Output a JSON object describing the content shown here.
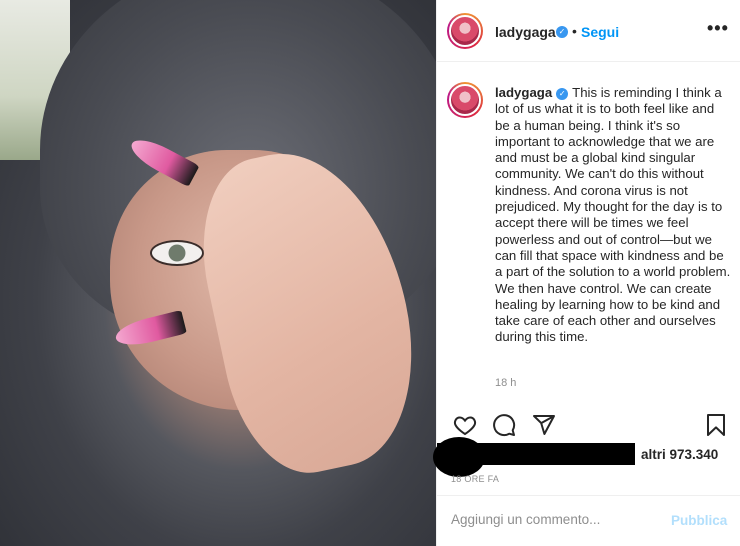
{
  "post": {
    "username": "ladygaga",
    "verified_mark": "✓",
    "separator": "•",
    "follow_label": "Segui",
    "more_label": "•••",
    "caption": "This is reminding I think a lot of us what it is to both feel like and be a human being. I think it's so important to acknowledge that we are and must be a global kind singular community. We can't do this without kindness. And corona virus is not prejudiced. My thought for the day is to accept there will be times we feel powerless and out of control—but we can fill that space with kindness and be a part of the solution to a world problem. We then have control. We can create healing by learning how to be kind and take care of each other and ourselves during this time.",
    "caption_time": "18 h",
    "likes_text": "altri 973.340",
    "posted_ago": "18 ORE FA"
  },
  "comment": {
    "placeholder": "Aggiungi un commento...",
    "publish_label": "Pubblica"
  },
  "icons": {
    "like": "heart-icon",
    "comment": "comment-bubble-icon",
    "share": "paper-plane-icon",
    "save": "bookmark-icon"
  },
  "colors": {
    "link_blue": "#0095f6",
    "verified_blue": "#3897f0",
    "publish_disabled": "#b2dffc",
    "muted_text": "#8e8e8e"
  }
}
